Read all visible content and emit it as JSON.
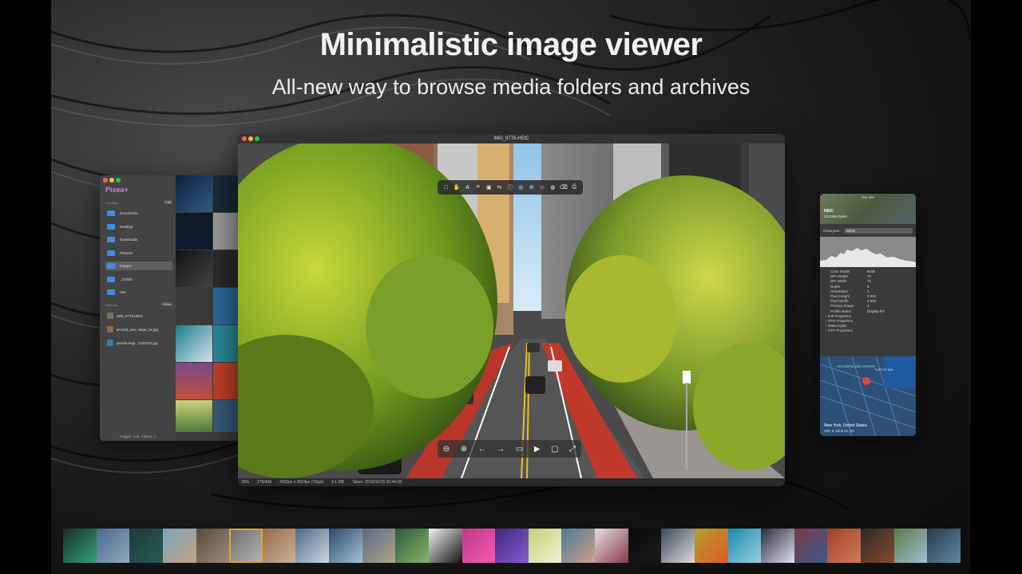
{
  "headline": "Minimalistic image viewer",
  "subhead": "All-new way to browse media folders and archives",
  "viewer": {
    "title": "IMG_8776.HEIC",
    "status": {
      "zoom": "39%",
      "index": "278/439",
      "dimensions": "4032px x 3024px (72ppi)",
      "filesize": "4.1 MB",
      "taken": "Taken: 2019/10/15 16:44:28"
    }
  },
  "sidebar": {
    "brand": "Pixea+",
    "favorites_label": "Favorites",
    "favorites_edit": "Edit",
    "favorites": [
      {
        "label": "Documents"
      },
      {
        "label": "Desktop"
      },
      {
        "label": "Downloads"
      },
      {
        "label": "Pictures"
      },
      {
        "label": "Images",
        "selected": true
      },
      {
        "label": "_2XB01"
      },
      {
        "label": "raw"
      }
    ],
    "recents_label": "Recents",
    "recents_clear": "Clear",
    "recents": [
      {
        "label": "IMG_8776.HEIC",
        "color": "#6b7a5c"
      },
      {
        "label": "around_you...large_2x.jpg",
        "color": "#8a6a3e"
      },
      {
        "label": "pexels-engi...1435752.jpg",
        "color": "#2f7fa8"
      }
    ],
    "status": "Images: 148, Videos: 1"
  },
  "info": {
    "title": "Get Info",
    "format": "HEIC",
    "size": "4111368 bytes",
    "histogram_label": "Histogram:",
    "histogram_value": "White",
    "properties": [
      {
        "k": "Color Model",
        "v": "RGB"
      },
      {
        "k": "DPI Height",
        "v": "72"
      },
      {
        "k": "DPI Width",
        "v": "72"
      },
      {
        "k": "Depth",
        "v": "8"
      },
      {
        "k": "Orientation",
        "v": "1"
      },
      {
        "k": "Pixel Height",
        "v": "3 024"
      },
      {
        "k": "Pixel Width",
        "v": "4 032"
      },
      {
        "k": "Primary Image",
        "v": "1"
      },
      {
        "k": "Profile Name",
        "v": "Display P3"
      }
    ],
    "groups": [
      "Exif Properties",
      "GPS Properties",
      "MakerApple",
      "TIFF Properties"
    ],
    "map_location": "New York, United States",
    "map_address": "320, E 42nd St, NY",
    "map_label_1": "ROCKEFELLER CENTER",
    "map_label_2": "TURTLE BAY"
  },
  "colors": {
    "accent_brand": "#d57bd8",
    "folder_blue": "#3d8ee0",
    "filmstrip_selected": "#e0a628",
    "map_pin": "#e0453a"
  },
  "filmstrip": [
    {
      "c1": "#1d2b2a",
      "c2": "#2fa37a"
    },
    {
      "c1": "#4a6a8a",
      "c2": "#93a8bb"
    },
    {
      "c1": "#1d3b3a",
      "c2": "#275a55"
    },
    {
      "c1": "#7aa6c4",
      "c2": "#c2a37c"
    },
    {
      "c1": "#5a4a3a",
      "c2": "#9a8a7a"
    },
    {
      "c1": "#6a6a6a",
      "c2": "#b5b5b5",
      "selected": true
    },
    {
      "c1": "#9a6a4a",
      "c2": "#c8b29a"
    },
    {
      "c1": "#4a6a8a",
      "c2": "#cfd6dc"
    },
    {
      "c1": "#2a4a6a",
      "c2": "#a5c2d6"
    },
    {
      "c1": "#5a6a8a",
      "c2": "#b0a48a"
    },
    {
      "c1": "#2a5a3a",
      "c2": "#88b36a"
    },
    {
      "c1": "#f2f2f2",
      "c2": "#111111"
    },
    {
      "c1": "#c23a8a",
      "c2": "#f05ab0"
    },
    {
      "c1": "#3a2a7a",
      "c2": "#8a5ad0"
    },
    {
      "c1": "#c8d07a",
      "c2": "#f0f0d0"
    },
    {
      "c1": "#4a7a9a",
      "c2": "#d0a08a"
    },
    {
      "c1": "#e0e0e0",
      "c2": "#8a3a4a"
    },
    {
      "c1": "#0a0a0a",
      "c2": "#1a1a1a"
    },
    {
      "c1": "#3a4a5a",
      "c2": "#dcdcdc"
    },
    {
      "c1": "#b0a02a",
      "c2": "#e05a2a"
    },
    {
      "c1": "#1a8ab0",
      "c2": "#9ad0e0"
    },
    {
      "c1": "#2a2a3a",
      "c2": "#e0e0f0"
    },
    {
      "c1": "#7a3a4a",
      "c2": "#3a5a8a"
    },
    {
      "c1": "#a0402a",
      "c2": "#d07a5a"
    },
    {
      "c1": "#2a2a2a",
      "c2": "#8a4a2a"
    },
    {
      "c1": "#5a7a4a",
      "c2": "#a0c0d0"
    },
    {
      "c1": "#2a3a4a",
      "c2": "#5a8aa0"
    }
  ]
}
